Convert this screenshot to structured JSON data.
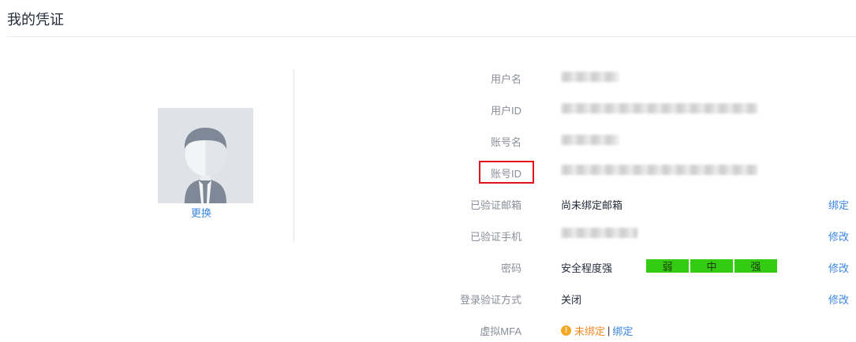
{
  "page": {
    "title": "我的凭证"
  },
  "avatar": {
    "change_label": "更换"
  },
  "fields": {
    "username": {
      "label": "用户名"
    },
    "user_id": {
      "label": "用户ID"
    },
    "account_name": {
      "label": "账号名"
    },
    "account_id": {
      "label": "账号ID"
    },
    "email": {
      "label": "已验证邮箱",
      "value": "尚未绑定邮箱",
      "action": "绑定"
    },
    "phone": {
      "label": "已验证手机",
      "action": "修改"
    },
    "password": {
      "label": "密码",
      "value": "安全程度强",
      "strength_levels": [
        "弱",
        "中",
        "强"
      ],
      "strength_color": "#33cc12",
      "action": "修改"
    },
    "login_verify": {
      "label": "登录验证方式",
      "value": "关闭",
      "action": "修改"
    },
    "mfa": {
      "label": "虚拟MFA",
      "status": "未绑定",
      "separator": "|",
      "action": "绑定",
      "status_icon": "warning-icon"
    }
  },
  "colors": {
    "link": "#3b86e3",
    "highlight": "#e1121b",
    "warning": "#f5a623"
  }
}
